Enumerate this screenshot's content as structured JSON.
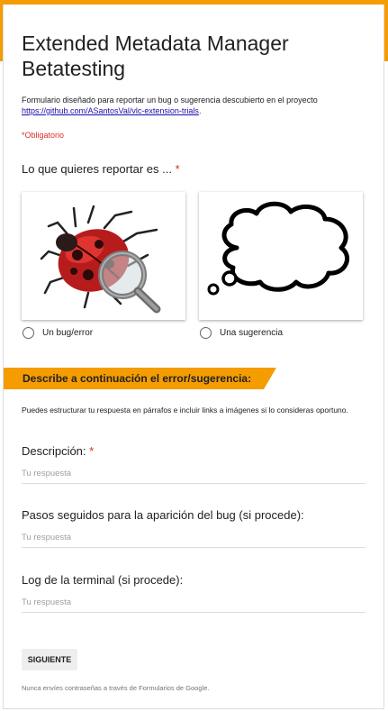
{
  "form": {
    "title": "Extended Metadata Manager Betatesting",
    "description_text": "Formulario diseñado para reportar un bug o sugerencia descubierto en el proyecto",
    "description_link": "https://github.com/ASantosVal/vlc-extension-trials",
    "description_end": ".",
    "required_note": "*Obligatorio"
  },
  "q1": {
    "title": "Lo que quieres reportar es ...",
    "required_mark": "*",
    "options": [
      {
        "label": "Un bug/error",
        "icon": "bug-magnifier-image"
      },
      {
        "label": "Una sugerencia",
        "icon": "thought-bubble-image"
      }
    ]
  },
  "section2": {
    "title": "Describe a continuación el error/sugerencia:",
    "description": "Puedes estructurar tu respuesta en párrafos e incluir links a imágenes si lo consideras oportuno."
  },
  "questions": [
    {
      "title": "Descripción:",
      "required_mark": "*",
      "placeholder": "Tu respuesta"
    },
    {
      "title": "Pasos seguidos para la aparición del bug (si procede):",
      "placeholder": "Tu respuesta"
    },
    {
      "title": "Log de la terminal (si procede):",
      "placeholder": "Tu respuesta"
    }
  ],
  "actions": {
    "next_label": "SIGUIENTE"
  },
  "footer": {
    "note": "Nunca envíes contraseñas a través de Formularios de Google."
  },
  "colors": {
    "accent": "#f59c00",
    "required": "#d93025",
    "link": "#1a0dab"
  }
}
